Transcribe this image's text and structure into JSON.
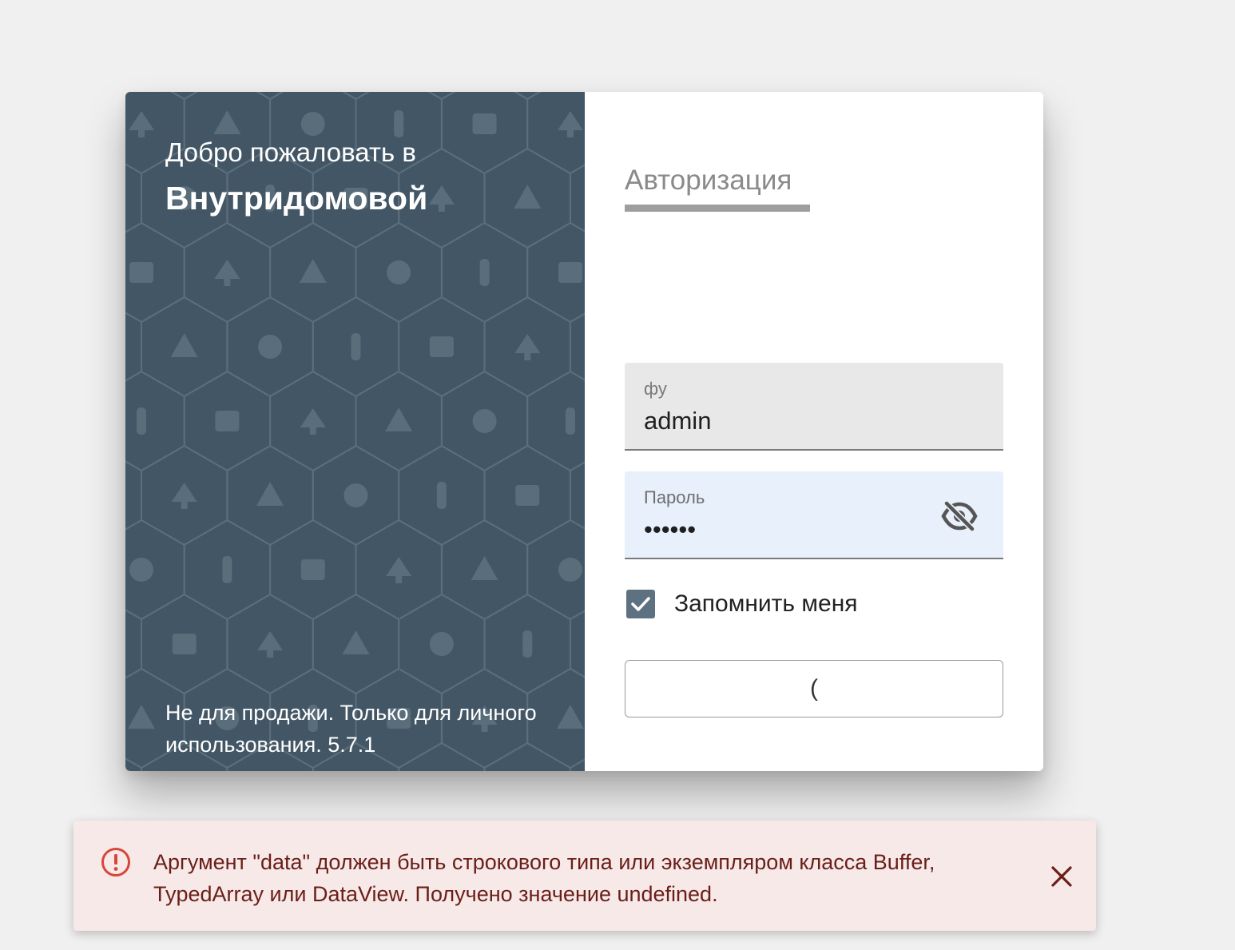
{
  "welcome": {
    "line1": "Добро пожаловать в",
    "brand": "Внутридомовой"
  },
  "footer": {
    "note": "Не для продажи. Только для личного использования. 5.7.1"
  },
  "auth": {
    "tab_label": "Авторизация",
    "login": {
      "label": "фу",
      "value": "admin"
    },
    "password": {
      "label": "Пароль",
      "value": "••••••",
      "toggle_icon": "eye-off-icon"
    },
    "remember": {
      "label": "Запомнить меня",
      "checked": true
    },
    "submit_label": "("
  },
  "toast": {
    "icon": "error-circle-icon",
    "message": "Аргумент \"data\" должен быть строкового типа или экземпляром класса Buffer, TypedArray или DataView. Получено значение undefined.",
    "close_icon": "close-icon"
  },
  "colors": {
    "panel_bg": "#435665",
    "checkbox": "#5d7181",
    "toast_bg": "#f6e9e8",
    "toast_text": "#6b1e18",
    "toast_icon": "#d9453a",
    "page_bg": "#f0f0f0"
  }
}
